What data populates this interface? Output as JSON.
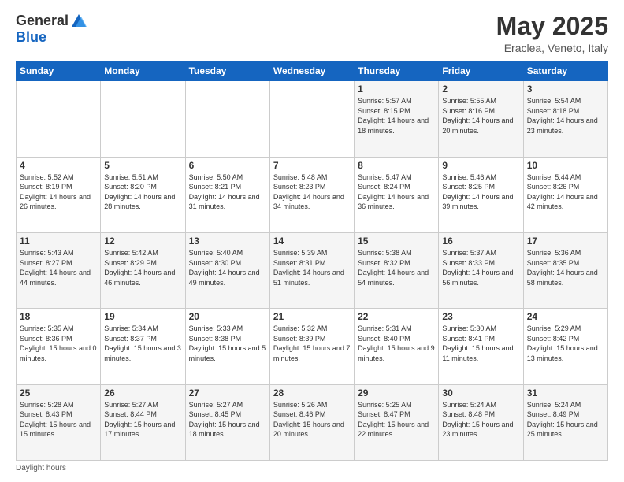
{
  "header": {
    "logo_general": "General",
    "logo_blue": "Blue",
    "month_title": "May 2025",
    "subtitle": "Eraclea, Veneto, Italy"
  },
  "days_of_week": [
    "Sunday",
    "Monday",
    "Tuesday",
    "Wednesday",
    "Thursday",
    "Friday",
    "Saturday"
  ],
  "weeks": [
    [
      {
        "day": "",
        "sunrise": "",
        "sunset": "",
        "daylight": ""
      },
      {
        "day": "",
        "sunrise": "",
        "sunset": "",
        "daylight": ""
      },
      {
        "day": "",
        "sunrise": "",
        "sunset": "",
        "daylight": ""
      },
      {
        "day": "",
        "sunrise": "",
        "sunset": "",
        "daylight": ""
      },
      {
        "day": "1",
        "sunrise": "Sunrise: 5:57 AM",
        "sunset": "Sunset: 8:15 PM",
        "daylight": "Daylight: 14 hours and 18 minutes."
      },
      {
        "day": "2",
        "sunrise": "Sunrise: 5:55 AM",
        "sunset": "Sunset: 8:16 PM",
        "daylight": "Daylight: 14 hours and 20 minutes."
      },
      {
        "day": "3",
        "sunrise": "Sunrise: 5:54 AM",
        "sunset": "Sunset: 8:18 PM",
        "daylight": "Daylight: 14 hours and 23 minutes."
      }
    ],
    [
      {
        "day": "4",
        "sunrise": "Sunrise: 5:52 AM",
        "sunset": "Sunset: 8:19 PM",
        "daylight": "Daylight: 14 hours and 26 minutes."
      },
      {
        "day": "5",
        "sunrise": "Sunrise: 5:51 AM",
        "sunset": "Sunset: 8:20 PM",
        "daylight": "Daylight: 14 hours and 28 minutes."
      },
      {
        "day": "6",
        "sunrise": "Sunrise: 5:50 AM",
        "sunset": "Sunset: 8:21 PM",
        "daylight": "Daylight: 14 hours and 31 minutes."
      },
      {
        "day": "7",
        "sunrise": "Sunrise: 5:48 AM",
        "sunset": "Sunset: 8:23 PM",
        "daylight": "Daylight: 14 hours and 34 minutes."
      },
      {
        "day": "8",
        "sunrise": "Sunrise: 5:47 AM",
        "sunset": "Sunset: 8:24 PM",
        "daylight": "Daylight: 14 hours and 36 minutes."
      },
      {
        "day": "9",
        "sunrise": "Sunrise: 5:46 AM",
        "sunset": "Sunset: 8:25 PM",
        "daylight": "Daylight: 14 hours and 39 minutes."
      },
      {
        "day": "10",
        "sunrise": "Sunrise: 5:44 AM",
        "sunset": "Sunset: 8:26 PM",
        "daylight": "Daylight: 14 hours and 42 minutes."
      }
    ],
    [
      {
        "day": "11",
        "sunrise": "Sunrise: 5:43 AM",
        "sunset": "Sunset: 8:27 PM",
        "daylight": "Daylight: 14 hours and 44 minutes."
      },
      {
        "day": "12",
        "sunrise": "Sunrise: 5:42 AM",
        "sunset": "Sunset: 8:29 PM",
        "daylight": "Daylight: 14 hours and 46 minutes."
      },
      {
        "day": "13",
        "sunrise": "Sunrise: 5:40 AM",
        "sunset": "Sunset: 8:30 PM",
        "daylight": "Daylight: 14 hours and 49 minutes."
      },
      {
        "day": "14",
        "sunrise": "Sunrise: 5:39 AM",
        "sunset": "Sunset: 8:31 PM",
        "daylight": "Daylight: 14 hours and 51 minutes."
      },
      {
        "day": "15",
        "sunrise": "Sunrise: 5:38 AM",
        "sunset": "Sunset: 8:32 PM",
        "daylight": "Daylight: 14 hours and 54 minutes."
      },
      {
        "day": "16",
        "sunrise": "Sunrise: 5:37 AM",
        "sunset": "Sunset: 8:33 PM",
        "daylight": "Daylight: 14 hours and 56 minutes."
      },
      {
        "day": "17",
        "sunrise": "Sunrise: 5:36 AM",
        "sunset": "Sunset: 8:35 PM",
        "daylight": "Daylight: 14 hours and 58 minutes."
      }
    ],
    [
      {
        "day": "18",
        "sunrise": "Sunrise: 5:35 AM",
        "sunset": "Sunset: 8:36 PM",
        "daylight": "Daylight: 15 hours and 0 minutes."
      },
      {
        "day": "19",
        "sunrise": "Sunrise: 5:34 AM",
        "sunset": "Sunset: 8:37 PM",
        "daylight": "Daylight: 15 hours and 3 minutes."
      },
      {
        "day": "20",
        "sunrise": "Sunrise: 5:33 AM",
        "sunset": "Sunset: 8:38 PM",
        "daylight": "Daylight: 15 hours and 5 minutes."
      },
      {
        "day": "21",
        "sunrise": "Sunrise: 5:32 AM",
        "sunset": "Sunset: 8:39 PM",
        "daylight": "Daylight: 15 hours and 7 minutes."
      },
      {
        "day": "22",
        "sunrise": "Sunrise: 5:31 AM",
        "sunset": "Sunset: 8:40 PM",
        "daylight": "Daylight: 15 hours and 9 minutes."
      },
      {
        "day": "23",
        "sunrise": "Sunrise: 5:30 AM",
        "sunset": "Sunset: 8:41 PM",
        "daylight": "Daylight: 15 hours and 11 minutes."
      },
      {
        "day": "24",
        "sunrise": "Sunrise: 5:29 AM",
        "sunset": "Sunset: 8:42 PM",
        "daylight": "Daylight: 15 hours and 13 minutes."
      }
    ],
    [
      {
        "day": "25",
        "sunrise": "Sunrise: 5:28 AM",
        "sunset": "Sunset: 8:43 PM",
        "daylight": "Daylight: 15 hours and 15 minutes."
      },
      {
        "day": "26",
        "sunrise": "Sunrise: 5:27 AM",
        "sunset": "Sunset: 8:44 PM",
        "daylight": "Daylight: 15 hours and 17 minutes."
      },
      {
        "day": "27",
        "sunrise": "Sunrise: 5:27 AM",
        "sunset": "Sunset: 8:45 PM",
        "daylight": "Daylight: 15 hours and 18 minutes."
      },
      {
        "day": "28",
        "sunrise": "Sunrise: 5:26 AM",
        "sunset": "Sunset: 8:46 PM",
        "daylight": "Daylight: 15 hours and 20 minutes."
      },
      {
        "day": "29",
        "sunrise": "Sunrise: 5:25 AM",
        "sunset": "Sunset: 8:47 PM",
        "daylight": "Daylight: 15 hours and 22 minutes."
      },
      {
        "day": "30",
        "sunrise": "Sunrise: 5:24 AM",
        "sunset": "Sunset: 8:48 PM",
        "daylight": "Daylight: 15 hours and 23 minutes."
      },
      {
        "day": "31",
        "sunrise": "Sunrise: 5:24 AM",
        "sunset": "Sunset: 8:49 PM",
        "daylight": "Daylight: 15 hours and 25 minutes."
      }
    ]
  ],
  "footer": "Daylight hours"
}
